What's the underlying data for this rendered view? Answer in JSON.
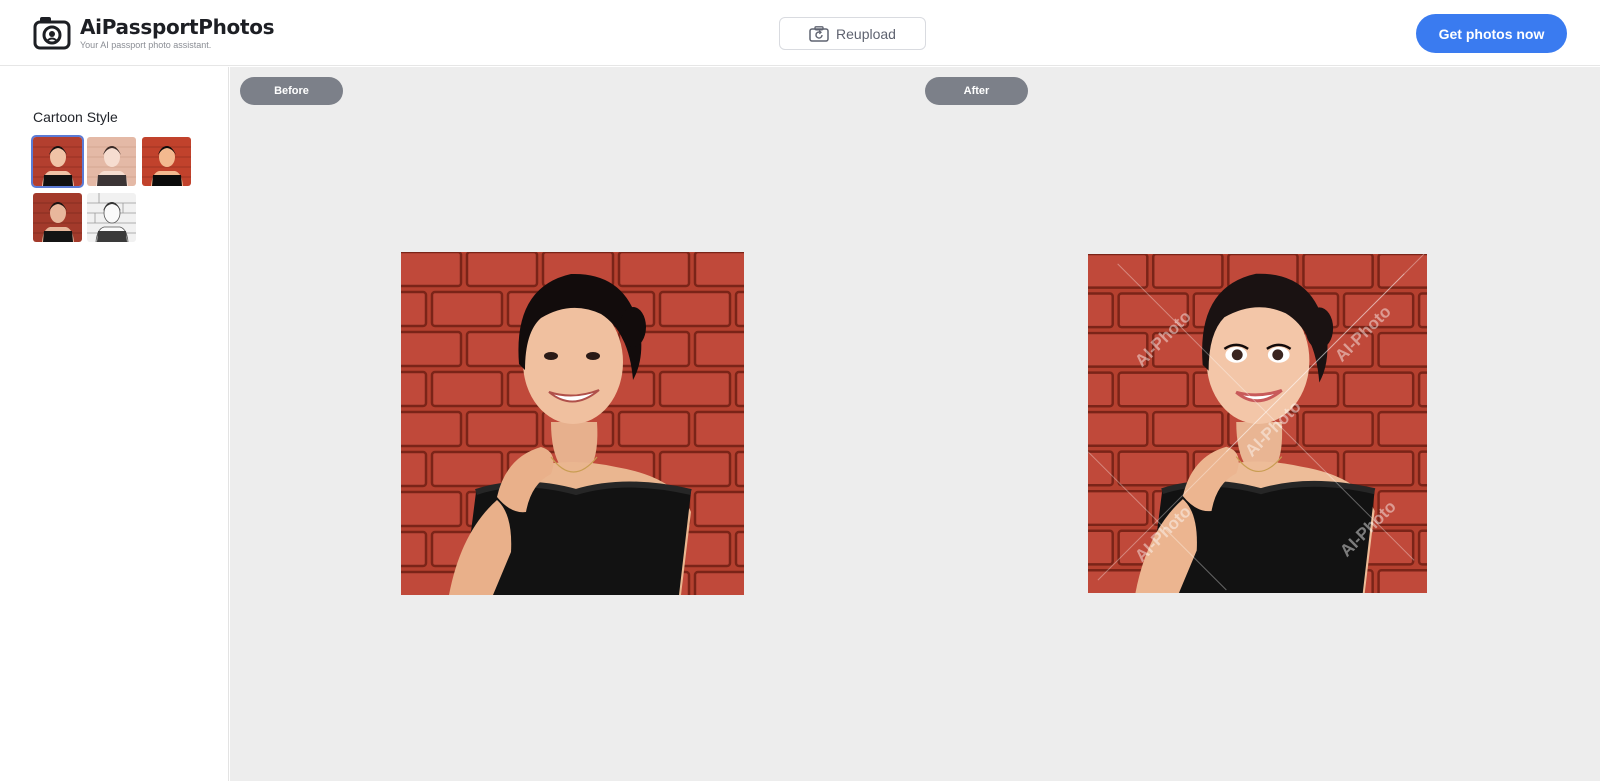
{
  "header": {
    "brand_name": "AiPassportPhotos",
    "brand_tagline": "Your AI passport photo assistant.",
    "reupload_label": "Reupload",
    "cta_label": "Get photos now"
  },
  "sidebar": {
    "title": "Cartoon Style",
    "styles": [
      {
        "name": "style-1",
        "selected": true
      },
      {
        "name": "style-2",
        "selected": false
      },
      {
        "name": "style-3",
        "selected": false
      },
      {
        "name": "style-4",
        "selected": false
      },
      {
        "name": "style-5",
        "selected": false
      }
    ]
  },
  "compare": {
    "before_label": "Before",
    "after_label": "After",
    "watermark": "AI-Photo"
  },
  "colors": {
    "brand_blue": "#3a7bf0",
    "brick": "#b33f2f",
    "pill_gray": "#7c8089",
    "canvas_bg": "#ededed"
  }
}
